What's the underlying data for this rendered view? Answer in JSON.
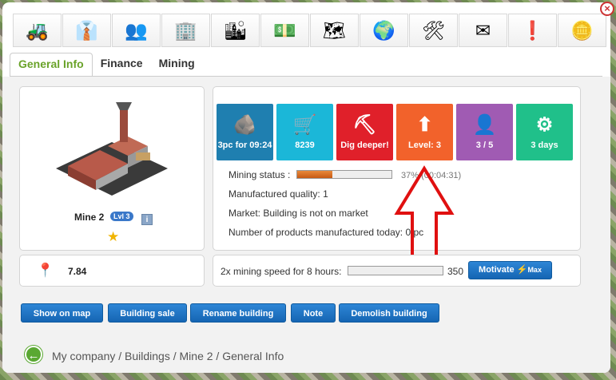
{
  "toolbar": {
    "icons": [
      {
        "name": "bulldozer-icon",
        "glyph": "🚜"
      },
      {
        "name": "manager-icon",
        "glyph": "👔"
      },
      {
        "name": "staff-icon",
        "glyph": "👥"
      },
      {
        "name": "office-building-icon",
        "glyph": "🏢"
      },
      {
        "name": "city-buildings-icon",
        "glyph": "🏙"
      },
      {
        "name": "money-icon",
        "glyph": "💵"
      },
      {
        "name": "map-key-icon",
        "glyph": "🗺"
      },
      {
        "name": "globe-icon",
        "glyph": "🌍"
      },
      {
        "name": "tools-icon",
        "glyph": "🛠"
      },
      {
        "name": "mail-icon",
        "glyph": "✉"
      },
      {
        "name": "alert-icon",
        "glyph": "❗"
      },
      {
        "name": "coin-icon",
        "glyph": "🪙"
      }
    ]
  },
  "close_glyph": "×",
  "tabs": {
    "general": "General Info",
    "finance": "Finance",
    "mining": "Mining"
  },
  "building": {
    "name": "Mine 2",
    "level_badge": "Lvl 3",
    "info_glyph": "i",
    "star_glyph": "★",
    "image_glyph": "🏭"
  },
  "tiles": [
    {
      "label": "3pc for 09:24",
      "icon": "🪨",
      "color": "#1f7fb0"
    },
    {
      "label": "8239",
      "icon": "🛒",
      "color": "#1bb7d8"
    },
    {
      "label": "Dig deeper!",
      "icon": "⛏",
      "color": "#e0202a"
    },
    {
      "label": "Level: 3",
      "icon": "⬆",
      "color": "#f2622b"
    },
    {
      "label": "3 / 5",
      "icon": "👤",
      "color": "#a05bb3"
    },
    {
      "label": "3 days",
      "icon": "⚙",
      "color": "#20c08a"
    }
  ],
  "status": {
    "mining_label": "Mining status :",
    "mining_progress": 0.37,
    "mining_pct_text": "37% (00:04:31)",
    "quality": "Manufactured quality: 1",
    "market": "Market: Building is not on market",
    "products_today": "Number of products manufactured today: 0 pc"
  },
  "stats": {
    "map_value": "7.84",
    "map_icon": "📍"
  },
  "motivate": {
    "label": "2x mining speed for 8 hours:",
    "progress": 0.0,
    "value": "350",
    "button": "Motivate",
    "button_bolt": "⚡",
    "button_max": "Max"
  },
  "actions": {
    "show_on_map": "Show on map",
    "building_sale": "Building sale",
    "rename": "Rename building",
    "note": "Note",
    "demolish": "Demolish building"
  },
  "breadcrumb": "My company / Buildings / Mine 2 / General Info",
  "back_glyph": "←",
  "colors": {
    "accent_green": "#6aa32a",
    "action_blue": "#1a73c4",
    "arrow_red": "#e01010"
  }
}
